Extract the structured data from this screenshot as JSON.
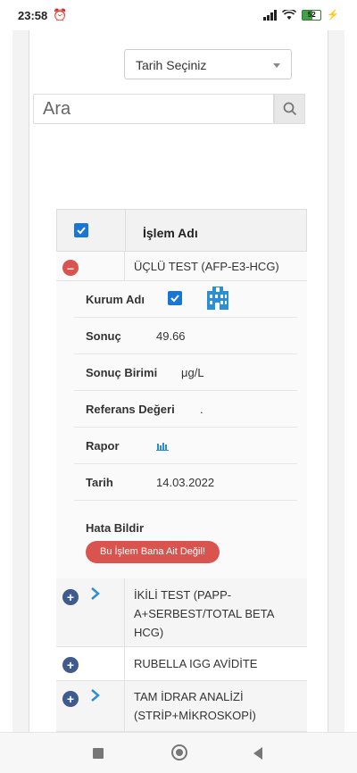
{
  "status_bar": {
    "time": "23:58",
    "battery": "52"
  },
  "filters": {
    "date_select": "Tarih Seçiniz",
    "search_placeholder": "Ara"
  },
  "table": {
    "header": "İşlem Adı",
    "rows": [
      {
        "label": "ÜÇLÜ TEST (AFP-E3-HCG)",
        "expanded": true
      },
      {
        "label": "İKİLİ TEST (PAPP-A+SERBEST/TOTAL BETA HCG)"
      },
      {
        "label": "RUBELLA IGG AVİDİTE"
      },
      {
        "label": "TAM İDRAR ANALİZİ (STRİP+MİKROSKOPİ)"
      }
    ],
    "detail": {
      "institution_label": "Kurum Adı",
      "result_label": "Sonuç",
      "result_value": "49.66",
      "unit_label": "Sonuç Birimi",
      "unit_value": "μg/L",
      "reference_label": "Referans Değeri",
      "reference_value": ".",
      "report_label": "Rapor",
      "date_label": "Tarih",
      "date_value": "14.03.2022",
      "error_label": "Hata Bildir",
      "error_button": "Bu İşlem Bana Ait Değil!"
    }
  },
  "colors": {
    "checkbox": "#1976d2",
    "minus": "#d9534f",
    "plus": "#3f5a8c",
    "accent_icon": "#2b8fd6"
  }
}
